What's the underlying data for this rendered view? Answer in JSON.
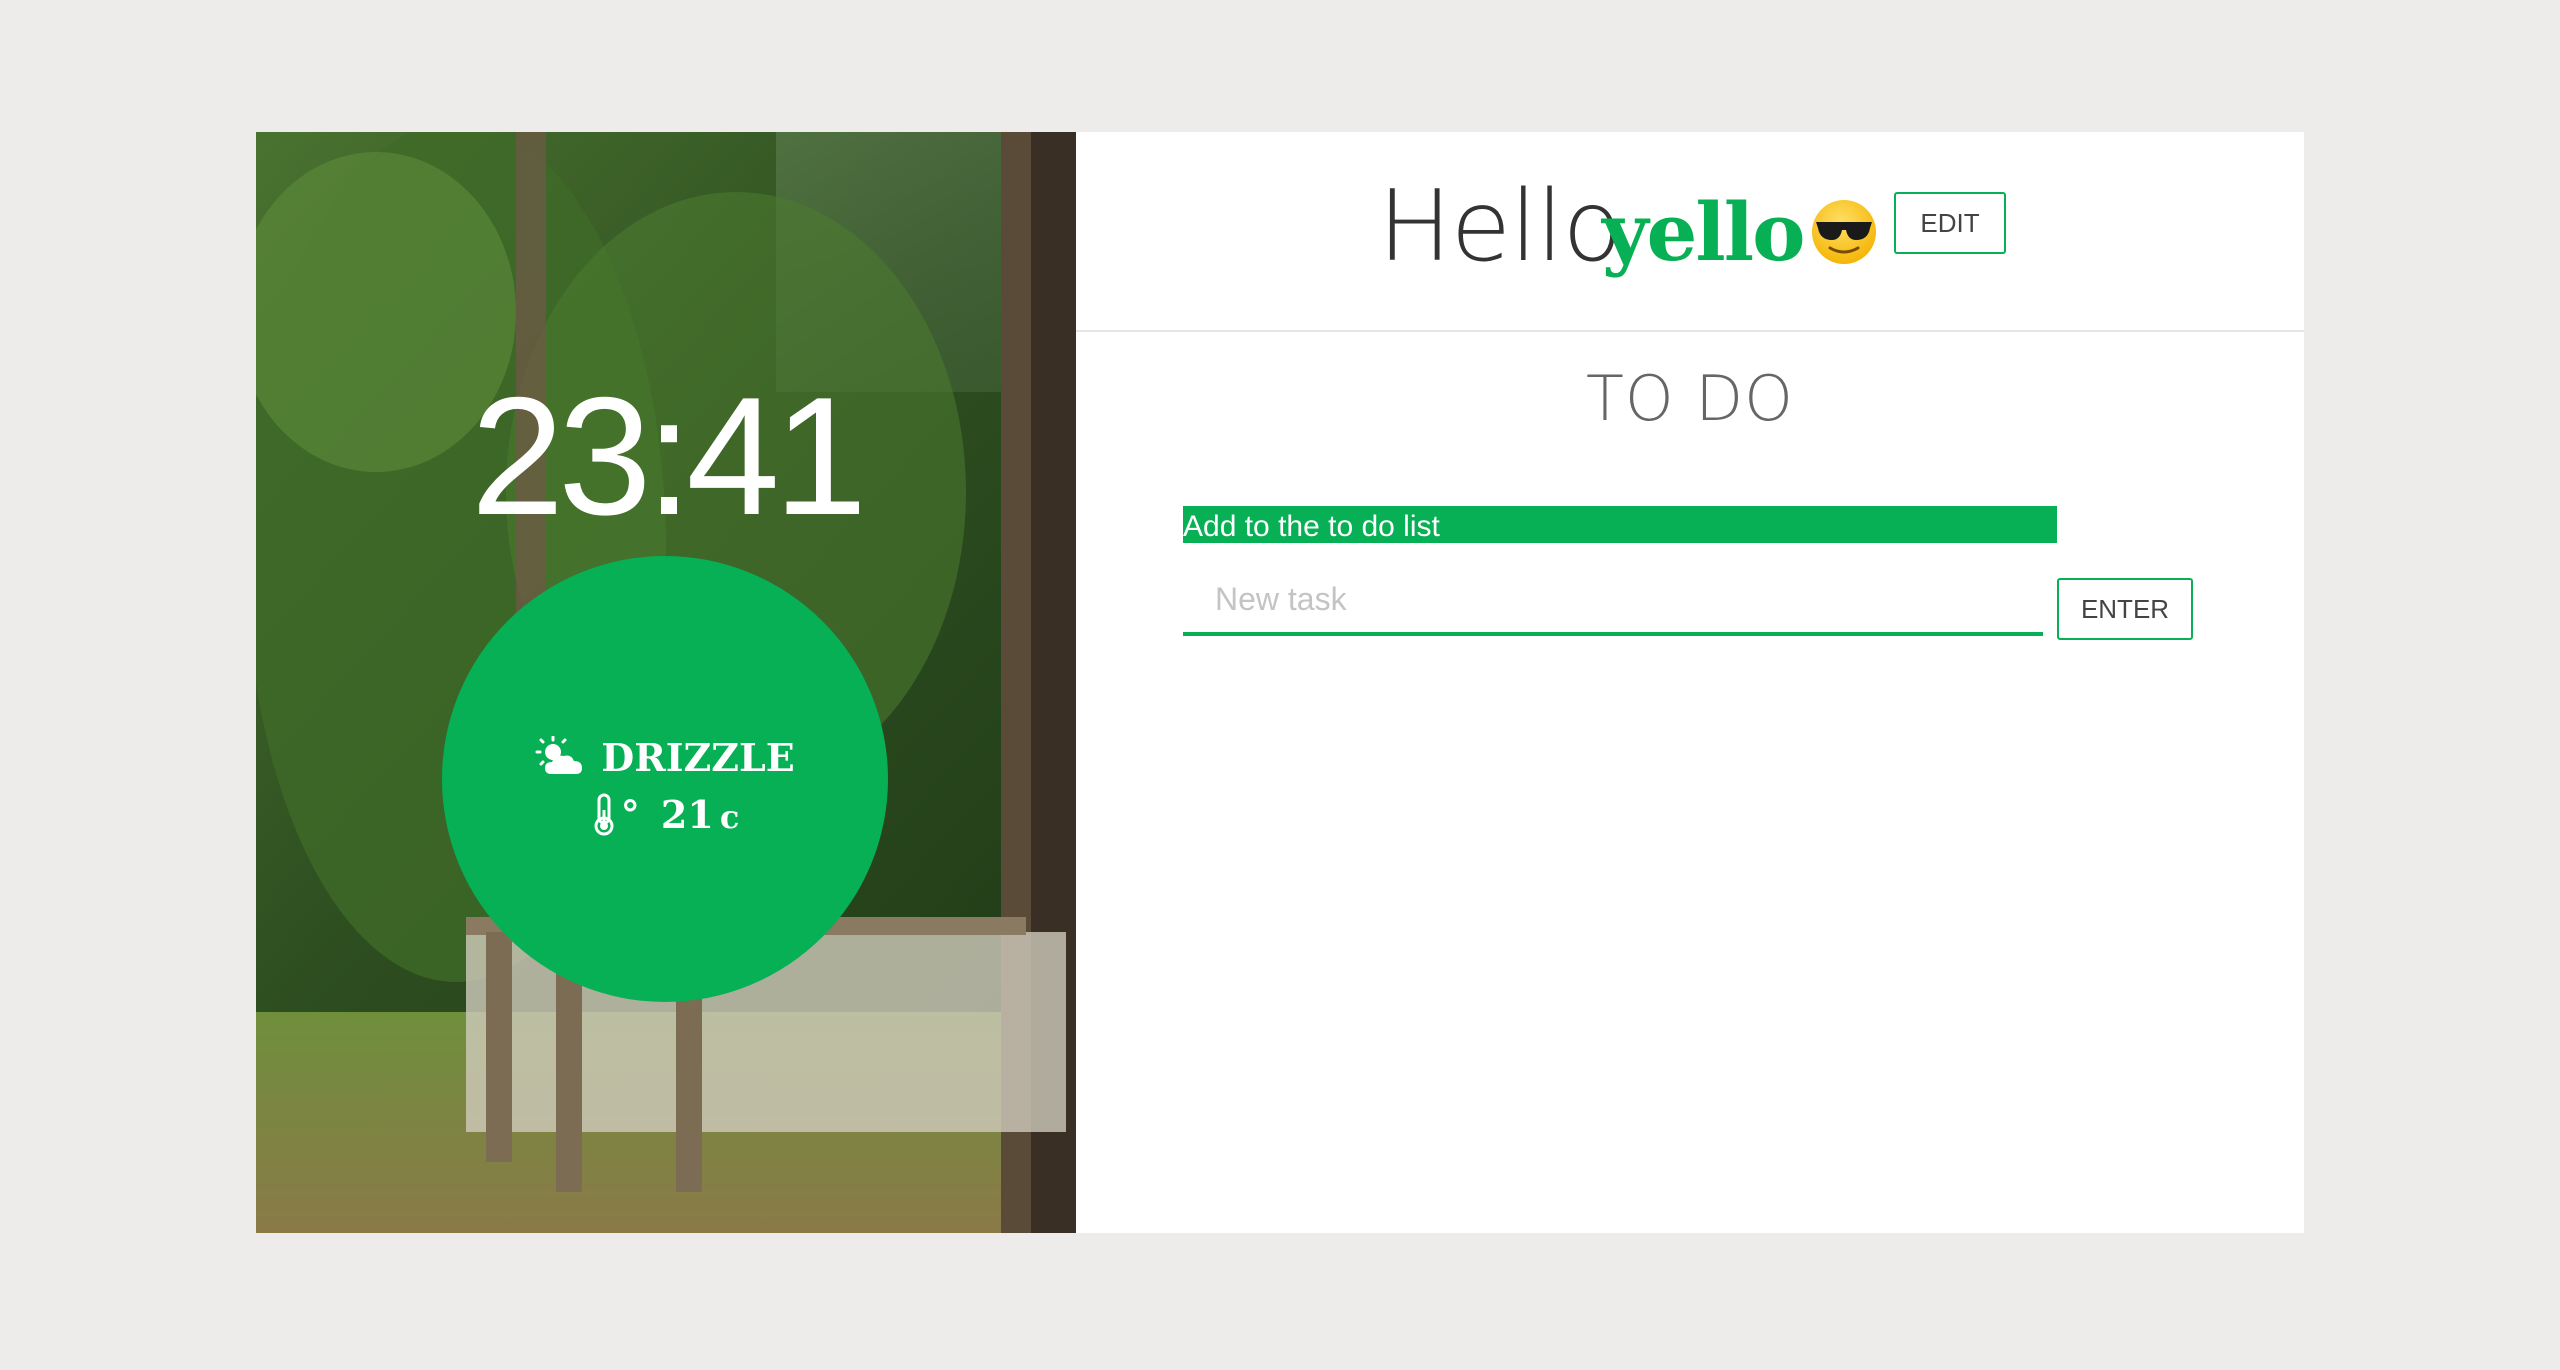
{
  "clock": {
    "time": "23:41"
  },
  "weather": {
    "condition": "DRIZZLE",
    "condition_icon": "partly-cloudy-icon",
    "temperature_icon": "thermometer-icon",
    "temperature_prefix": "°",
    "temperature": "21",
    "unit": "c"
  },
  "greeting": {
    "hello": "Hello",
    "name": "yello",
    "emoji": "sunglasses-emoji",
    "edit_label": "EDIT"
  },
  "todo": {
    "title": "TO DO",
    "add_label": "Add to the to do list",
    "input_placeholder": "New task",
    "input_value": "",
    "enter_label": "ENTER"
  },
  "colors": {
    "accent": "#07b055",
    "page_background": "#edecea",
    "card_background": "#ffffff"
  }
}
